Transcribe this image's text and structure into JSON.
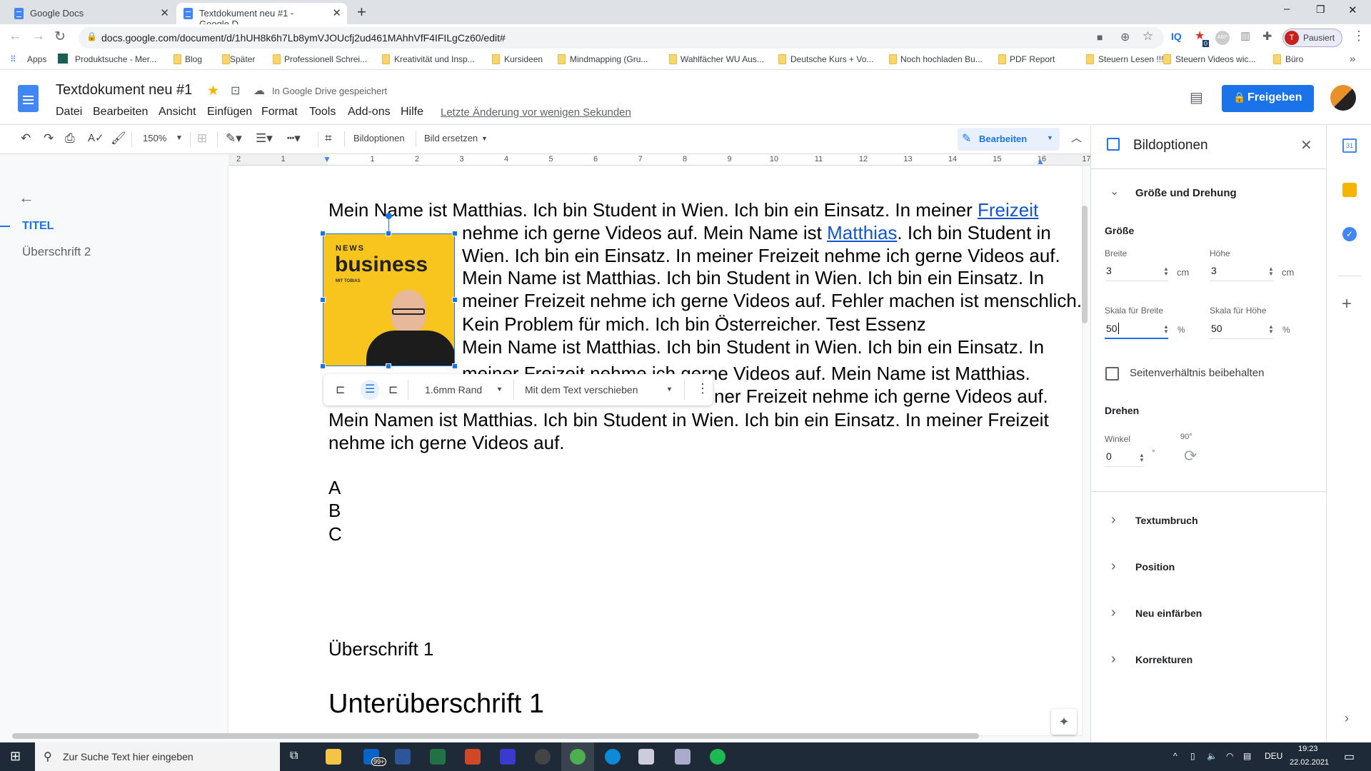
{
  "browser": {
    "tabs": [
      {
        "label": "Google Docs",
        "active": false
      },
      {
        "label": "Textdokument neu #1 - Google D",
        "active": true
      }
    ],
    "new_tab": "+",
    "window_controls": [
      "–",
      "❐",
      "✕"
    ],
    "url": "docs.google.com/document/d/1hUH8k6h7Lb8ymVJOUcfj2ud461MAhhVfF4IFILgCz60/edit#",
    "extension_badge": "0",
    "ext_iq": "IQ",
    "ext_abp": "ABP",
    "profile": {
      "initial": "T",
      "label": "Pausiert"
    },
    "bookmarks": [
      "Apps",
      "Produktsuche - Mer...",
      "Blog",
      "Später",
      "Professionell Schrei...",
      "Kreativität und Insp...",
      "Kursideen",
      "Mindmapping  (Gru...",
      "Wahlfächer WU Aus...",
      "Deutsche Kurs + Vo...",
      "Noch hochladen Bu...",
      "PDF Report",
      "Steuern Lesen !!!!",
      "Steuern Videos wic...",
      "Büro"
    ],
    "bookmarks_more": "»"
  },
  "docs": {
    "title": "Textdokument neu #1",
    "save_status": "In Google Drive gespeichert",
    "menu": [
      "Datei",
      "Bearbeiten",
      "Ansicht",
      "Einfügen",
      "Format",
      "Tools",
      "Add-ons",
      "Hilfe"
    ],
    "last_edit": "Letzte Änderung vor wenigen Sekunden",
    "share_label": "Freigeben",
    "accent": "#1a73e8",
    "toolbar": {
      "zoom": "150%",
      "image_options": "Bildoptionen",
      "replace_image": "Bild ersetzen",
      "mode": "Bearbeiten"
    },
    "ruler": [
      "2",
      "1",
      "1",
      "2",
      "3",
      "4",
      "5",
      "6",
      "7",
      "8",
      "9",
      "10",
      "11",
      "12",
      "13",
      "14",
      "15",
      "16",
      "17"
    ]
  },
  "outline": {
    "items": [
      {
        "label": "TITEL",
        "active": true
      },
      {
        "label": "Überschrift 2",
        "active": false
      }
    ]
  },
  "document": {
    "line1": {
      "text": "Mein Name ist Matthias. Ich bin Student in Wien. Ich bin ein Einsatz. In meiner ",
      "link": "Freizeit"
    },
    "line2": {
      "pre": "nehme ich gerne Videos auf. Mein Name ist ",
      "link": "Matthias",
      "post": ". Ich bin Student in"
    },
    "wrapped_lines": [
      "Wien. Ich bin ein Einsatz. In meiner Freizeit nehme ich gerne Videos auf.",
      "Mein Name ist Matthias. Ich bin Student in Wien. Ich bin ein Einsatz. In",
      "meiner Freizeit nehme ich gerne Videos auf. Fehler machen ist menschlich.",
      "Kein Problem für mich. Ich bin Österreicher. Test Essenz",
      "Mein Name ist Matthias. Ich bin Student in Wien. Ich bin ein Einsatz. In",
      "meiner Freizeit nehme ich gerne Videos auf. Mein Name ist Matthias.",
      "ner Freizeit nehme ich gerne Videos auf."
    ],
    "full_lines": [
      "Mein Namen ist Matthias. Ich bin Student in Wien. Ich bin ein Einsatz. In meiner Freizeit",
      "nehme ich gerne Videos auf."
    ],
    "list": [
      "A",
      "B",
      "C"
    ],
    "heading1": "Überschrift 1",
    "subheading": "Unterüberschrift 1",
    "image": {
      "kicker": "NEWS",
      "title": "business",
      "byline": "MIT TOBIAS",
      "bg": "#f7c51e"
    },
    "image_toolbar": {
      "margin": "1.6mm Rand",
      "position": "Mit dem Text verschieben"
    }
  },
  "panel": {
    "title": "Bildoptionen",
    "section_open": "Größe und Drehung",
    "size_heading": "Größe",
    "width": {
      "label": "Breite",
      "value": "3",
      "unit": "cm"
    },
    "height": {
      "label": "Höhe",
      "value": "3",
      "unit": "cm"
    },
    "scale_width": {
      "label": "Skala für Breite",
      "value": "50",
      "unit": "%"
    },
    "scale_height": {
      "label": "Skala für Höhe",
      "value": "50",
      "unit": "%"
    },
    "keep_ratio": {
      "label": "Seitenverhältnis beibehalten",
      "checked": false
    },
    "rotate_heading": "Drehen",
    "angle": {
      "label": "Winkel",
      "value": "0",
      "unit": "°"
    },
    "rotate90": "90°",
    "sections": [
      "Textumbruch",
      "Position",
      "Neu einfärben",
      "Korrekturen"
    ]
  },
  "taskbar": {
    "search_placeholder": "Zur Suche Text hier eingeben",
    "mail_badge": "99+",
    "lang": "DEU",
    "time": "19:23",
    "date": "22.02.2021"
  }
}
